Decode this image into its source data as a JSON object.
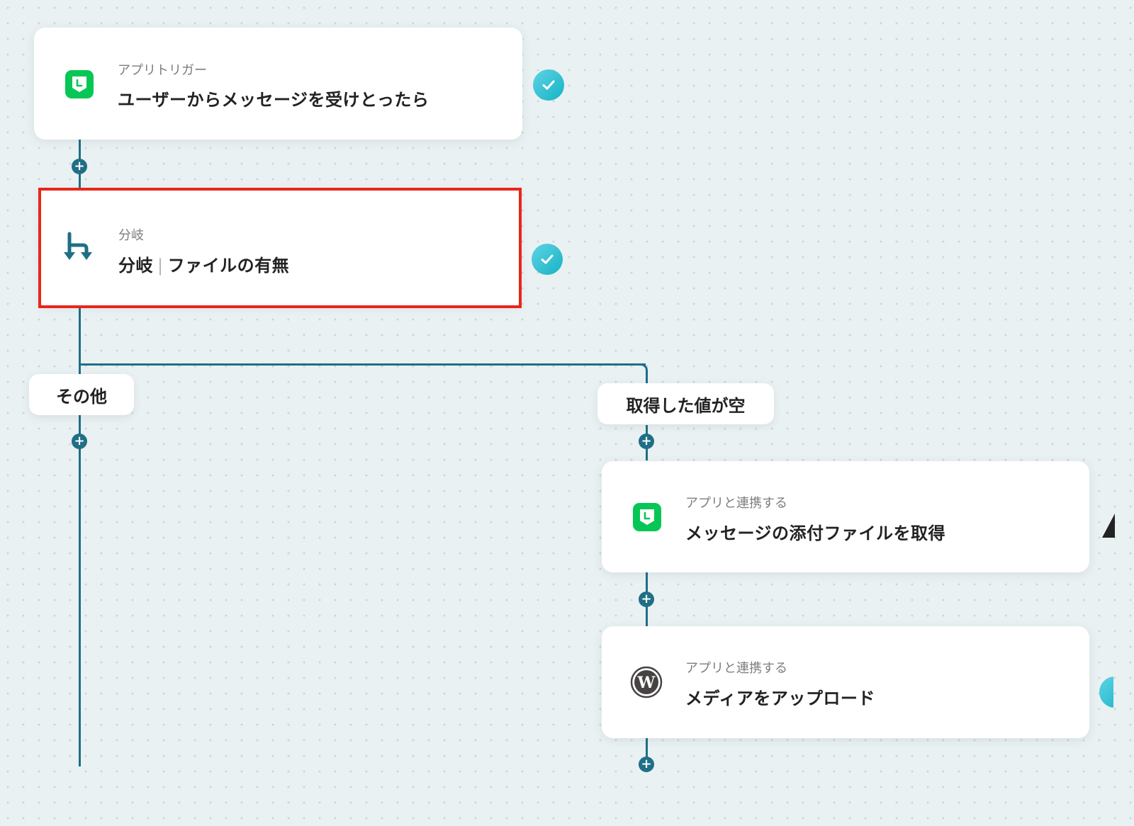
{
  "steps": {
    "trigger": {
      "subtitle": "アプリトリガー",
      "title": "ユーザーからメッセージを受けとったら",
      "icon": "line-app-icon",
      "status": "check-icon"
    },
    "branch": {
      "subtitle": "分岐",
      "title_main": "分岐",
      "title_separator": "|",
      "title_detail": "ファイルの有無",
      "icon": "branch-icon",
      "status": "check-icon"
    },
    "get_attachment": {
      "subtitle": "アプリと連携する",
      "title": "メッセージの添付ファイルを取得",
      "icon": "line-app-icon"
    },
    "upload_media": {
      "subtitle": "アプリと連携する",
      "title": "メディアをアップロード",
      "icon": "wordpress-icon"
    }
  },
  "branches": {
    "other": {
      "label": "その他"
    },
    "empty": {
      "label": "取得した値が空"
    }
  },
  "add_step_symbol": "+",
  "colors": {
    "connector": "#1f6f86",
    "line_brand": "#06c755",
    "check": "#15b3c3",
    "highlight": "#e8261a"
  }
}
